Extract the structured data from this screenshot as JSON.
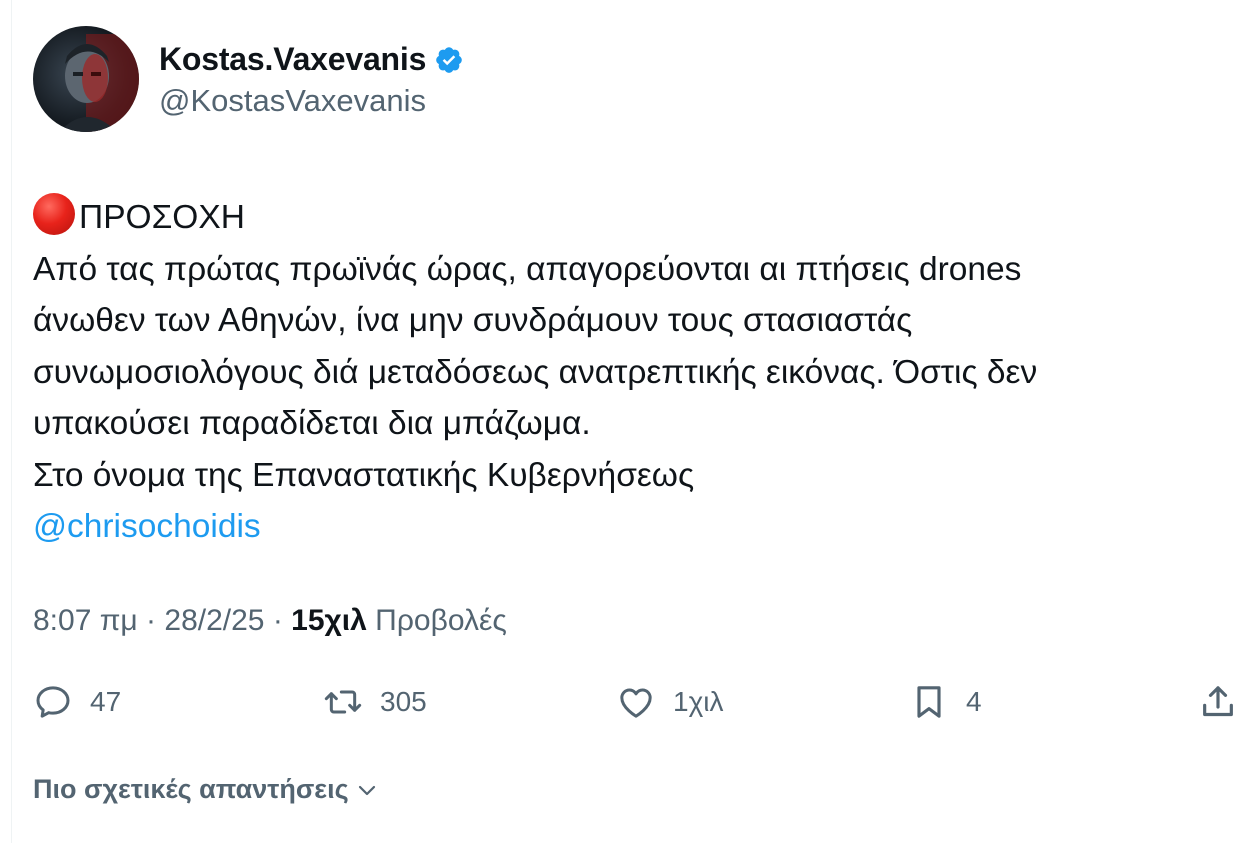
{
  "author": {
    "display_name": "Kostas.Vaxevanis",
    "handle": "@KostasVaxevanis",
    "verified_icon": "verified-badge-icon",
    "avatar_icon": "user-avatar"
  },
  "tweet": {
    "emoji": "red-circle-icon",
    "lines": [
      "ΠΡΟΣΟΧΗ",
      "Από τας πρώτας πρωϊνάς ώρας, απαγορεύονται αι πτήσεις drones",
      "άνωθεν των Αθηνών, ίνα μην συνδράμουν τους στασιαστάς",
      "συνωμοσιολόγους διά μεταδόσεως ανατρεπτικής εικόνας. Όστις δεν",
      "υπακούσει παραδίδεται δια μπάζωμα.",
      "Στο όνομα της Επαναστατικής Κυβερνήσεως"
    ],
    "mention": "@chrisochoidis"
  },
  "meta": {
    "time": "8:07 πμ",
    "sep1": " · ",
    "date": "28/2/25",
    "sep2": " · ",
    "views_count": "15χιλ",
    "views_label": " Προβολές"
  },
  "actions": {
    "replies": "47",
    "reposts": "305",
    "likes": "1χιλ",
    "bookmarks": "4"
  },
  "relevant_replies_label": "Πιο σχετικές απαντήσεις",
  "colors": {
    "text": "#0f1419",
    "secondary": "#536471",
    "link": "#1d9bf0",
    "verified": "#1d9bf0"
  }
}
